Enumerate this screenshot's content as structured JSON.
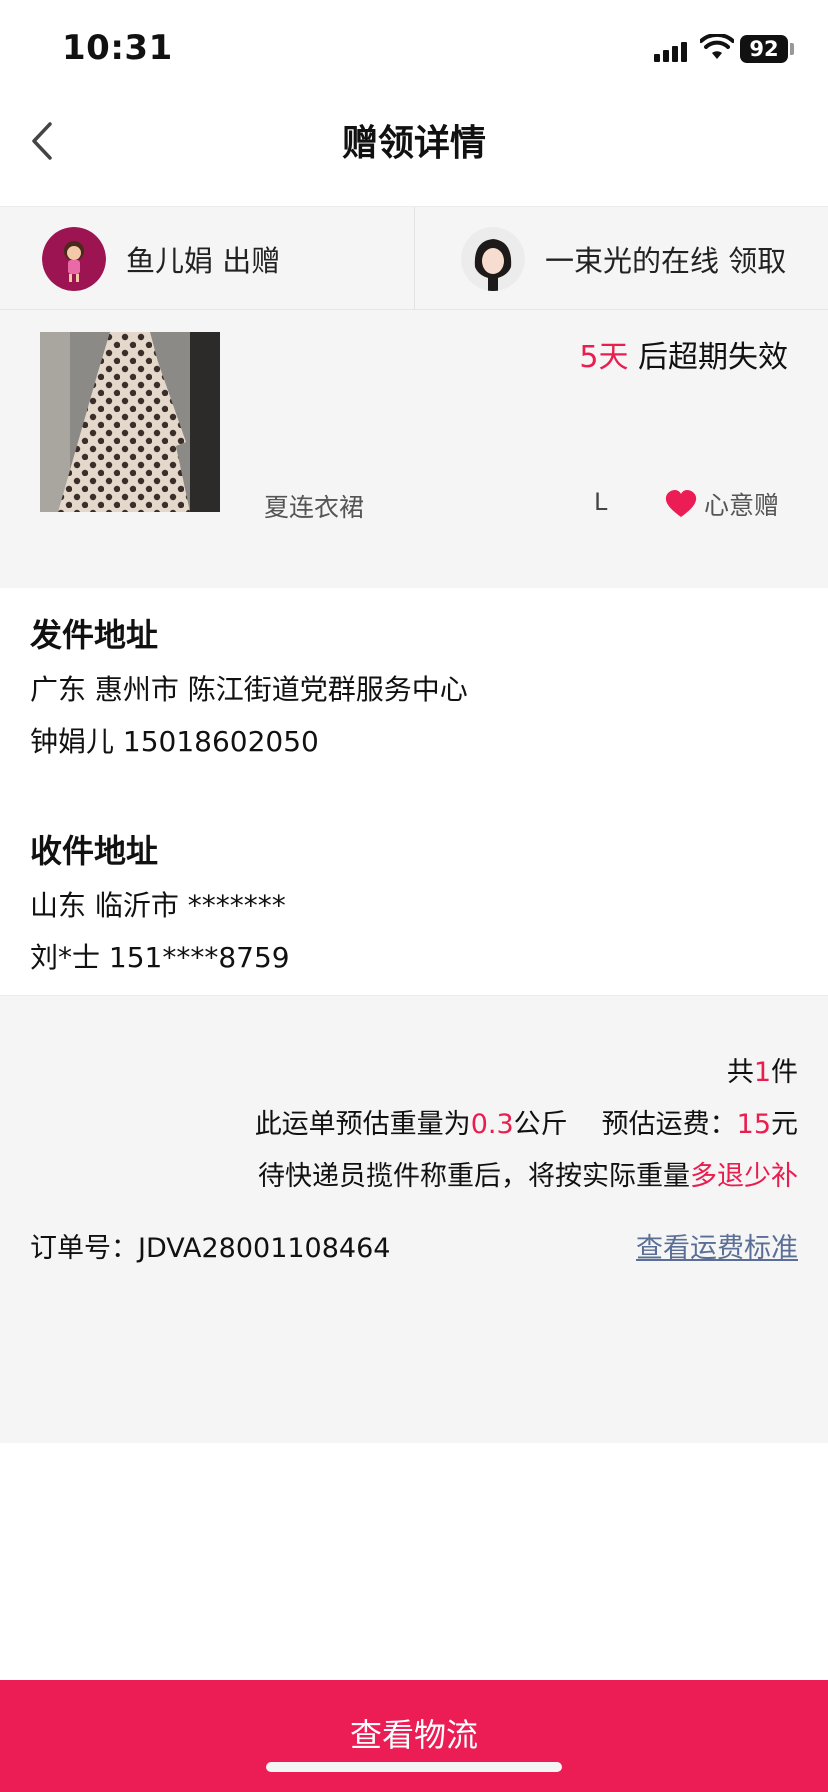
{
  "status_bar": {
    "time": "10:31",
    "battery": "92"
  },
  "nav": {
    "title": "赠领详情"
  },
  "participants": {
    "giver": "鱼儿娟 出赠",
    "receiver": "一束光的在线 领取"
  },
  "item": {
    "expiry_days": "5天",
    "expiry_suffix": " 后超期失效",
    "name": "夏连衣裙",
    "size": "L",
    "gift_type": "心意赠"
  },
  "sender_address": {
    "title": "发件地址",
    "address": "广东 惠州市 陈江街道党群服务中心",
    "contact": "钟娟儿 15018602050"
  },
  "receiver_address": {
    "title": "收件地址",
    "address": "山东 临沂市 *******",
    "contact": "刘*士 151****8759"
  },
  "shipping": {
    "count_prefix": "共",
    "count": "1",
    "count_suffix": "件",
    "weight_prefix": "此运单预估重量为",
    "weight": "0.3",
    "weight_unit": "公斤",
    "fee_label": "预估运费：",
    "fee": "15",
    "fee_unit": "元",
    "note": "待快递员揽件称重后，将按实际重量",
    "note_highlight": "多退少补",
    "order_label": "订单号：JDVA28001108464",
    "fee_standard_link": "查看运费标准"
  },
  "buttons": {
    "logistics": "查看物流"
  },
  "colors": {
    "accent": "#ec1c55",
    "highlight_red": "#e91e4f",
    "link": "#5b6f96",
    "panel_bg": "#f5f5f5"
  },
  "icons": [
    "signal-icon",
    "wifi-icon",
    "battery-icon",
    "back-arrow-icon",
    "heart-icon"
  ]
}
